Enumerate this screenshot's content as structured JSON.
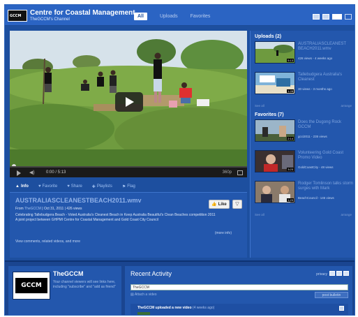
{
  "header": {
    "logo_text": "GCCM",
    "channel_title": "Centre for Coastal Management",
    "channel_subtitle": "TheGCCM's Channel",
    "tabs": [
      {
        "label": "All",
        "active": true
      },
      {
        "label": "Uploads",
        "active": false
      },
      {
        "label": "Favorites",
        "active": false
      }
    ],
    "accent_color": "#2b64c3"
  },
  "player": {
    "time": "0:00 / 5:13",
    "quality": "360p"
  },
  "subtabs": [
    {
      "label": "Info",
      "icon": "info-icon",
      "active": true
    },
    {
      "label": "Favorite",
      "icon": "heart-icon",
      "active": false
    },
    {
      "label": "Share",
      "icon": "share-icon",
      "active": false
    },
    {
      "label": "Playlists",
      "icon": "plus-icon",
      "active": false
    },
    {
      "label": "Flag",
      "icon": "flag-icon",
      "active": false
    }
  ],
  "info": {
    "title": "AUSTRALIASCLEANESTBEACH2011.wmv",
    "from_label": "From",
    "from_user": "TheGCCM",
    "date_views": "| Oct 31, 2011 | 426 views",
    "description_1": "Celebrating Tallebudgera Beach - Voted Australia's Cleanest Beach in Keep Australia Beautiful's Clean Beaches competition 2011",
    "description_2": "A joint project between GHPMI Centre for Coastal Management and Gold Coast City Council",
    "more_info": "(more info)",
    "view_comments": "View comments, related videos, and more",
    "like_label": "Like"
  },
  "uploads": {
    "title": "Uploads (2)",
    "items": [
      {
        "title": "AUSTRALIASCLEANEST BEACH2011.wmv",
        "meta": "426 views - 4 weeks ago",
        "duration": "5:13"
      },
      {
        "title": "Tallebudgera Australia's Cleanest",
        "meta": "30 views - 3 months ago",
        "duration": "1:28"
      }
    ],
    "see_all": "See all",
    "arrange": "arrange"
  },
  "favorites": {
    "title": "Favorites (7)",
    "items": [
      {
        "title": "Does the Dugong Rock GCCM",
        "meta": "gcci2011 - 235 views",
        "duration": "2:14"
      },
      {
        "title": "Volunteering Gold Coast Promo Video",
        "meta": "GoldCoastCity - 48 views",
        "duration": "3:23"
      },
      {
        "title": "Rodger Tomlinson talks storm surges with Mark",
        "meta": "BeachCouncil - 145 views",
        "duration": "1:23"
      }
    ],
    "see_all": "See all",
    "arrange": "arrange"
  },
  "profile": {
    "avatar_text": "GCCM",
    "name": "TheGCCM",
    "description": "Your channel viewers will see links here, including \"subscribe\" and \"add as friend\""
  },
  "activity": {
    "title": "Recent Activity",
    "privacy": "privacy",
    "input_value": "TheGCCM",
    "attach_label": "Attach a video",
    "post_button": "post bulletin",
    "item_text": "TheGCCM uploaded a new video",
    "item_time": "(4 weeks ago)"
  }
}
